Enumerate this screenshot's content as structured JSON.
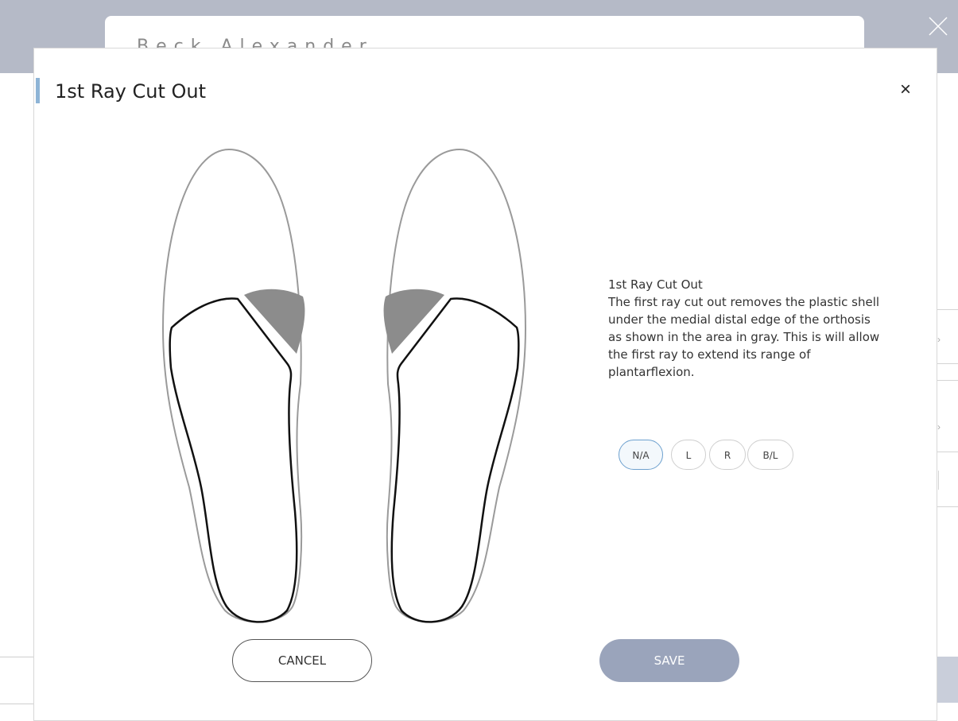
{
  "background": {
    "patient_name": "Beck Alexander",
    "close_icon": "close-icon"
  },
  "modal": {
    "title": "1st Ray Cut Out",
    "close_label": "×",
    "description": {
      "heading": "1st Ray Cut Out",
      "body": "The first ray cut out removes the plastic shell under the medial distal edge of the orthosis as shown in the area in gray. This is will allow the first ray to extend its range of plantarflexion."
    },
    "options": [
      {
        "label": "N/A",
        "selected": true
      },
      {
        "label": "L",
        "selected": false
      },
      {
        "label": "R",
        "selected": false
      },
      {
        "label": "B/L",
        "selected": false
      }
    ],
    "cancel_label": "CANCEL",
    "save_label": "SAVE"
  },
  "colors": {
    "accent": "#8eb4d6",
    "save_button": "#9aa4bb",
    "selected_border": "#6ea1cf",
    "cutout_gray": "#8c8c8c"
  },
  "illustration": {
    "left_insole_label": "left-insole",
    "right_insole_label": "right-insole"
  }
}
